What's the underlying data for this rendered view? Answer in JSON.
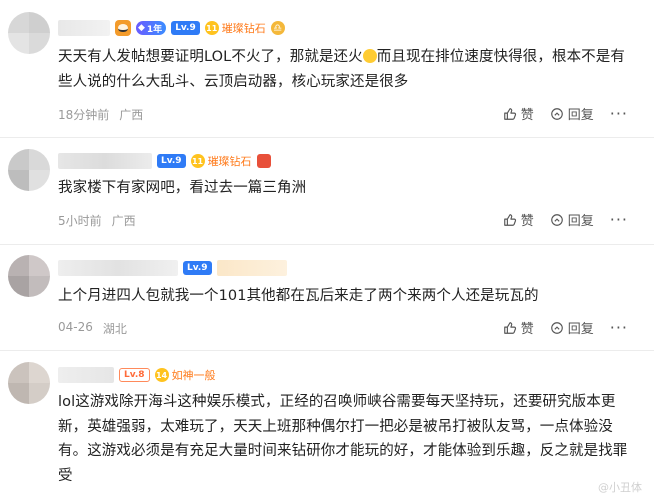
{
  "comments": [
    {
      "badges": {
        "year": "1年",
        "level": "Lv.9",
        "medal_num": "11",
        "medal": "璀璨钻石",
        "zodiac": "♎"
      },
      "text_parts": [
        "天天有人发帖想要证明LOL不火了，那就是还火",
        "而且现在排位速度快得很，根本不是有些人说的什么大乱斗、云顶启动器，核心玩家还是很多"
      ],
      "time": "18分钟前",
      "location": "广西",
      "like_label": "赞",
      "reply_label": "回复",
      "more": "···"
    },
    {
      "badges": {
        "level": "Lv.9",
        "medal_num": "11",
        "medal": "璀璨钻石"
      },
      "text": "我家楼下有家网吧，看过去一篇三角洲",
      "time": "5小时前",
      "location": "广西",
      "like_label": "赞",
      "reply_label": "回复",
      "more": "···"
    },
    {
      "badges": {
        "level": "Lv.9"
      },
      "text": "上个月进四人包就我一个101其他都在瓦后来走了两个来两个人还是玩瓦的",
      "time": "04-26",
      "location": "湖北",
      "like_label": "赞",
      "reply_label": "回复",
      "more": "···"
    },
    {
      "badges": {
        "level": "Lv.8",
        "medal_num": "14",
        "medal": "如神一般"
      },
      "text": "lol这游戏除开海斗这种娱乐模式，正经的召唤师峡谷需要每天坚持玩，还要研究版本更新，英雄强弱，太难玩了，天天上班那种偶尔打一把必是被吊打被队友骂，一点体验没有。这游戏必须是有充足大量时间来钻研你才能玩的好，才能体验到乐趣，反之就是找罪受"
    }
  ],
  "watermark": "@小丑体"
}
